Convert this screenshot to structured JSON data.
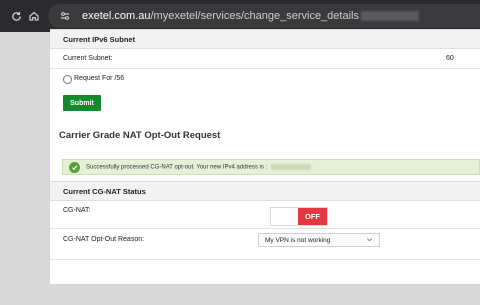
{
  "browser": {
    "url_domain": "exetel.com.au",
    "url_path": "/myexetel/services/change_service_details"
  },
  "ipv6": {
    "section_title": "Current IPv6 Subnet",
    "current_subnet_label": "Current Subnet:",
    "current_subnet_value": "60",
    "request_option_label": "Request For /56",
    "submit_label": "Submit"
  },
  "cgnat": {
    "title": "Carrier Grade NAT Opt-Out Request",
    "success_message": "Successfully processed CG-NAT opt-out. Your new IPv4 address is :",
    "status_section_title": "Current CG-NAT Status",
    "cgnat_label": "CG-NAT:",
    "toggle_state": "OFF",
    "reason_label": "CG-NAT Opt-Out Reason:",
    "reason_selected": "My VPN is not working"
  },
  "colors": {
    "submit_green": "#138a2c",
    "toggle_red": "#e2383f",
    "alert_bg": "#e4f1d6"
  }
}
